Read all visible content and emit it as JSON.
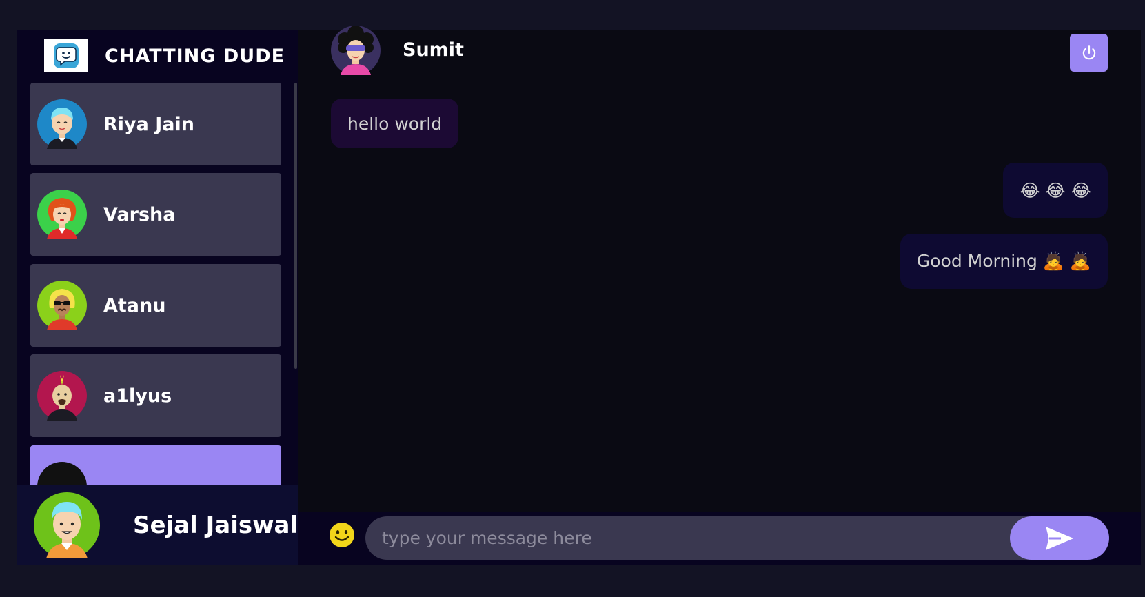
{
  "brand": {
    "title": "CHATTING DUDE",
    "logo_icon": "chat-bubble-face-icon"
  },
  "contacts": [
    {
      "name": "Riya Jain",
      "avatar_color": "#1e88c8"
    },
    {
      "name": "Varsha",
      "avatar_color": "#3bd14a"
    },
    {
      "name": "Atanu",
      "avatar_color": "#8bd11a"
    },
    {
      "name": "a1lyus",
      "avatar_color": "#b3164e"
    },
    {
      "name": "",
      "avatar_color": "#111111",
      "selected": true
    }
  ],
  "current_user": {
    "name": "Sejal Jaiswal",
    "avatar_color": "#6ec21a"
  },
  "chat": {
    "contact_name": "Sumit",
    "messages": [
      {
        "direction": "received",
        "text": "hello world"
      },
      {
        "direction": "sent",
        "text": "😂 😂 😂"
      },
      {
        "direction": "sent",
        "text": "Good Morning 🙇 🙇"
      }
    ]
  },
  "input": {
    "placeholder": "type your message here",
    "value": ""
  },
  "icons": {
    "logout": "power-icon",
    "send": "send-arrow-icon",
    "emoji": "smiley-icon"
  },
  "colors": {
    "accent": "#9a86f3",
    "background": "#131324",
    "contact_card": "#3a3850"
  }
}
